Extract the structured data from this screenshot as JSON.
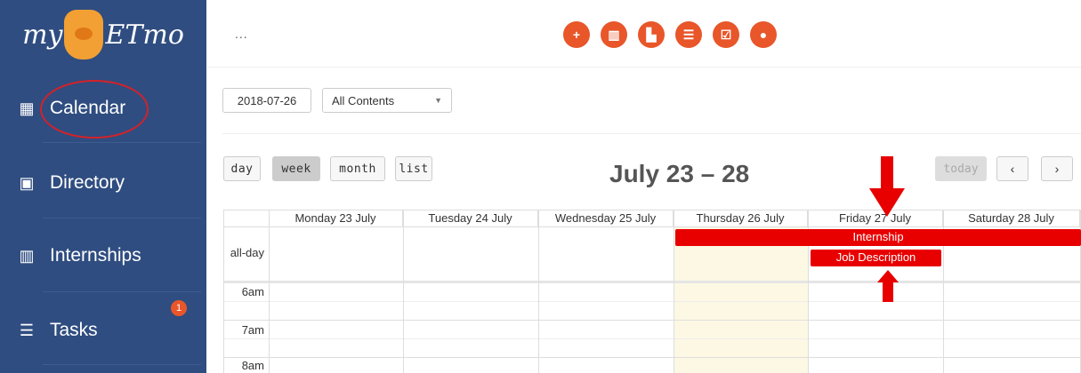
{
  "app": {
    "logo": "myVETmo"
  },
  "sidebar": {
    "items": [
      {
        "label": "Calendar",
        "icon": "calendar-icon"
      },
      {
        "label": "Directory",
        "icon": "contact-card-icon"
      },
      {
        "label": "Internships",
        "icon": "building-icon"
      },
      {
        "label": "Tasks",
        "icon": "list-icon",
        "badge": "1"
      }
    ]
  },
  "topbar": {
    "more": "...",
    "icons": [
      "add-user-icon",
      "building-icon",
      "factory-icon",
      "list-icon",
      "calendar-check-icon",
      "globe-icon"
    ]
  },
  "filters": {
    "date": "2018-07-26",
    "content_select": "All Contents"
  },
  "toolbar": {
    "day": "day",
    "week": "week",
    "month": "month",
    "list": "list",
    "title": "July 23 – 28",
    "today": "today",
    "prev": "‹",
    "next": "›"
  },
  "calendar": {
    "days": [
      "Monday 23 July",
      "Tuesday 24 July",
      "Wednesday 25 July",
      "Thursday 26 July",
      "Friday 27 July",
      "Saturday 28 July"
    ],
    "allday_label": "all-day",
    "times": [
      "6am",
      "7am",
      "8am"
    ],
    "events": {
      "internship": "Internship",
      "job_description": "Job Description"
    }
  },
  "colors": {
    "sidebar": "#2f4d80",
    "accent": "#e8562a",
    "event": "#e80000",
    "annotation": "#d3222a"
  }
}
